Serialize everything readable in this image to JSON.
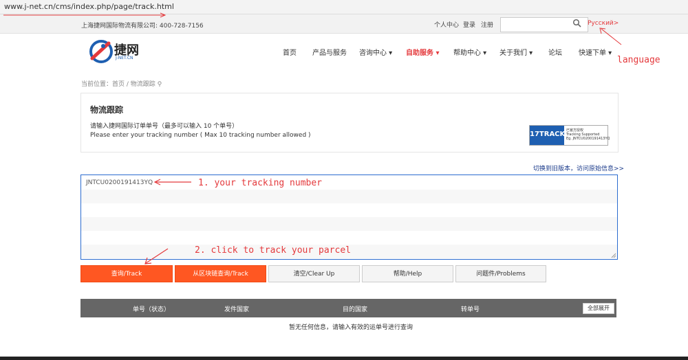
{
  "browser": {
    "url": "www.j-net.cn/cms/index.php/page/track.html"
  },
  "topbar": {
    "company_phone": "上海捷网国际物流有限公司: 400-728-7156",
    "links": [
      "个人中心",
      "登录",
      "注册"
    ],
    "search_placeholder": "",
    "language_link": "Русский>"
  },
  "logo": {
    "text": "捷网",
    "sub": "J-NET.CN"
  },
  "nav": [
    {
      "label": "首页"
    },
    {
      "label": "产品与服务"
    },
    {
      "label": "咨询中心 ▾"
    },
    {
      "label": "自助服务 ▾"
    },
    {
      "label": "帮助中心 ▾"
    },
    {
      "label": "关于我们 ▾"
    },
    {
      "label": "论坛"
    },
    {
      "label": "快速下单 ▾"
    }
  ],
  "breadcrumb": "当前位置：首页 /  物流跟踪 ⚲",
  "panel": {
    "title": "物流跟踪",
    "hint_cn": "请输入捷网国际订单单号（最多可以输入 10 个单号）",
    "hint_en": "Please enter your tracking number ( Max 10 tracking number allowed )",
    "track_badge": "17TRACK",
    "track_badge_sub": "已官方授权\nTracking Supported\nEg. JNTCU0200191413YQ"
  },
  "old_version_link": "切换到旧版本，访问原始信息>>",
  "tracking_input": {
    "value": "JNTCU0200191413YQ"
  },
  "annotations": {
    "language": "language",
    "step1": "1. your tracking number",
    "step2": "2. click to track your parcel"
  },
  "buttons": {
    "track": "查询/Track",
    "blockchain_track": "从区块链查询/Track",
    "clear": "清空/Clear Up",
    "help": "帮助/Help",
    "problems": "问题件/Problems"
  },
  "results_table": {
    "headers": [
      "单号（状态）",
      "发件国家",
      "目的国家",
      "转单号"
    ],
    "expand_all": "全部展开",
    "empty_message": "暂无任何信息，请输入有效的运单号进行查询"
  },
  "colors": {
    "accent": "#e4393c",
    "button_primary": "#ff5722",
    "header_bg": "#666666"
  }
}
